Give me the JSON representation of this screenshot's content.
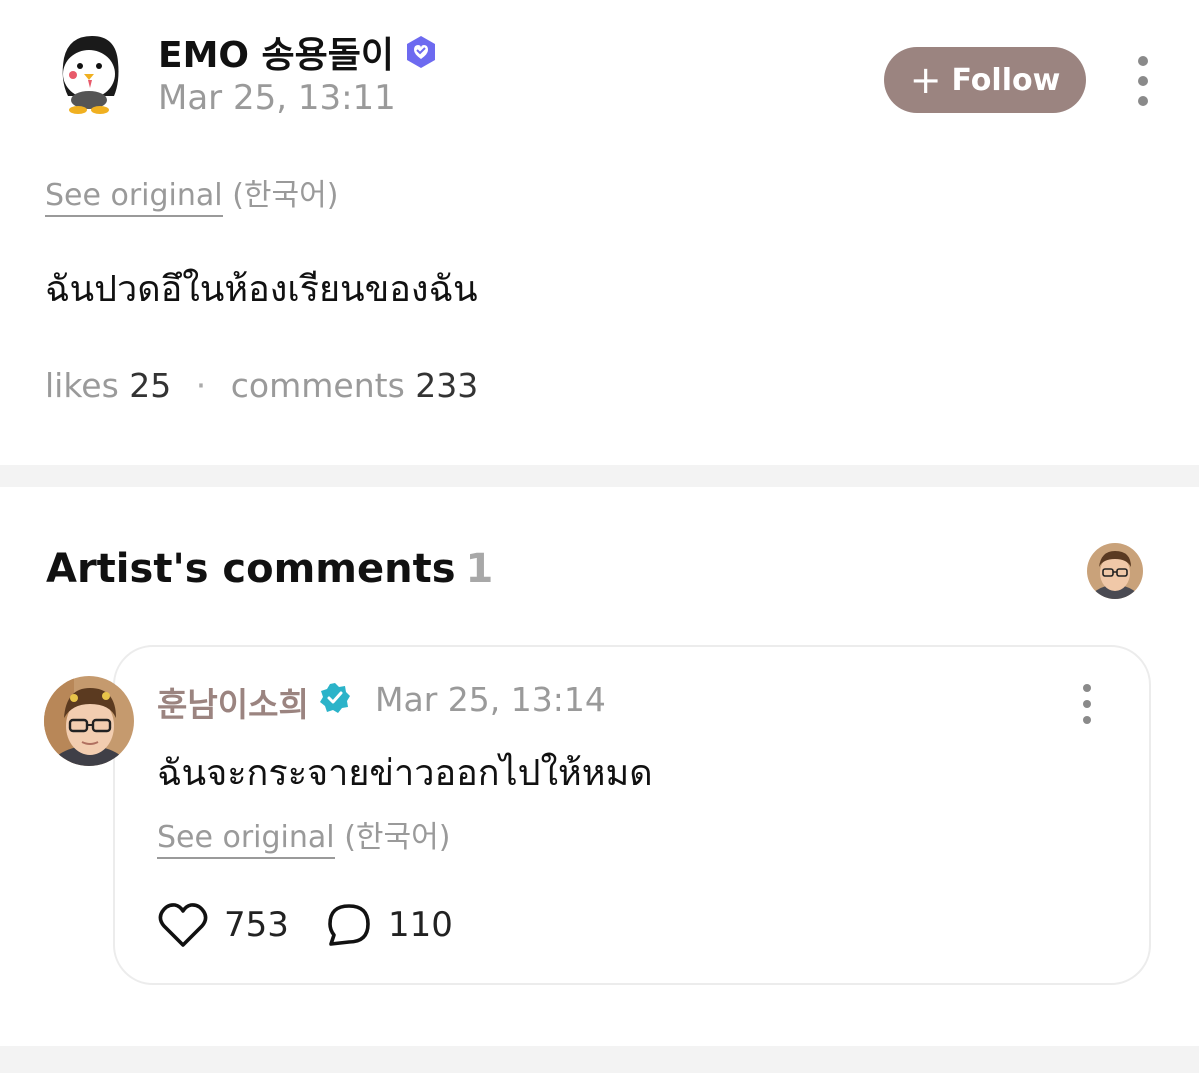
{
  "post": {
    "author_name": "EMO 송용돌이",
    "timestamp": "Mar 25, 13:11",
    "follow_label": "Follow",
    "see_original_label": "See original",
    "original_language": "(한국어)",
    "text": "ฉันปวดอึในห้องเรียนของฉัน",
    "likes_label": "likes",
    "likes_count": "25",
    "comments_label": "comments",
    "comments_count": "233"
  },
  "artist_comments": {
    "title": "Artist's comments",
    "count": "1",
    "comment": {
      "author_name": "훈남이소희",
      "timestamp": "Mar 25, 13:14",
      "text": "ฉันจะกระจายข่าวออกไปให้หมด",
      "see_original_label": "See original",
      "original_language": "(한국어)",
      "likes": "753",
      "replies": "110"
    }
  },
  "colors": {
    "accent": "#9b8480",
    "follow_button": "#9b8480",
    "verified_artist": "#2bb3c9",
    "verified_user": "#6d6af0",
    "muted_text": "#9a9a9a",
    "divider": "#f3f3f3"
  },
  "icons": {
    "post_verified": "verified-heart-badge-icon",
    "artist_verified": "verified-check-badge-icon",
    "more": "more-vertical-icon",
    "like": "heart-outline-icon",
    "reply": "speech-bubble-icon"
  }
}
